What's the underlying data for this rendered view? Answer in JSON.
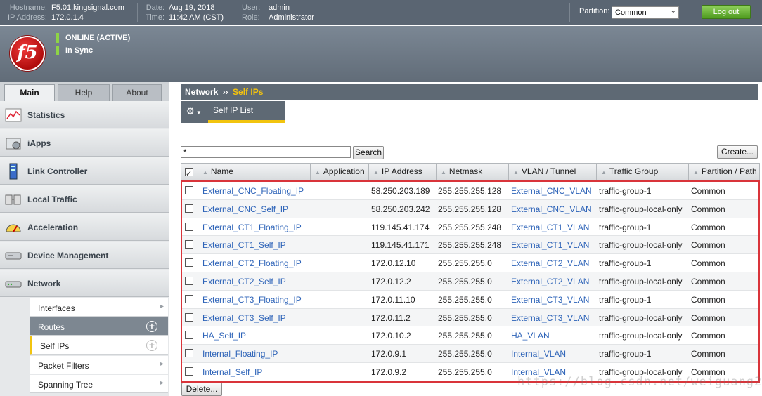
{
  "topbar": {
    "hostname_label": "Hostname:",
    "hostname": "F5.01.kingsignal.com",
    "ip_label": "IP Address:",
    "ip": "172.0.1.4",
    "date_label": "Date:",
    "date": "Aug 19, 2018",
    "time_label": "Time:",
    "time": "11:42 AM (CST)",
    "user_label": "User:",
    "user": "admin",
    "role_label": "Role:",
    "role": "Administrator",
    "partition_label": "Partition:",
    "partition_value": "Common",
    "logout_label": "Log out"
  },
  "header": {
    "logo_text": "f5",
    "status1": "ONLINE (ACTIVE)",
    "status2": "In Sync"
  },
  "tabs": [
    "Main",
    "Help",
    "About"
  ],
  "nav": {
    "items": [
      "Statistics",
      "iApps",
      "Link Controller",
      "Local Traffic",
      "Acceleration",
      "Device Management",
      "Network"
    ],
    "sub": [
      "Interfaces",
      "Routes",
      "Self IPs",
      "Packet Filters",
      "Spanning Tree"
    ]
  },
  "breadcrumb": {
    "section": "Network",
    "sep": "››",
    "current": "Self IPs"
  },
  "subtab": "Self IP List",
  "search": {
    "value": "*",
    "button": "Search"
  },
  "create_label": "Create...",
  "delete_label": "Delete...",
  "table": {
    "headers": [
      "Name",
      "Application",
      "IP Address",
      "Netmask",
      "VLAN / Tunnel",
      "Traffic Group",
      "Partition / Path"
    ],
    "rows": [
      {
        "name": "External_CNC_Floating_IP",
        "ip": "58.250.203.189",
        "mask": "255.255.255.128",
        "vlan": "External_CNC_VLAN",
        "tg": "traffic-group-1",
        "part": "Common"
      },
      {
        "name": "External_CNC_Self_IP",
        "ip": "58.250.203.242",
        "mask": "255.255.255.128",
        "vlan": "External_CNC_VLAN",
        "tg": "traffic-group-local-only",
        "part": "Common"
      },
      {
        "name": "External_CT1_Floating_IP",
        "ip": "119.145.41.174",
        "mask": "255.255.255.248",
        "vlan": "External_CT1_VLAN",
        "tg": "traffic-group-1",
        "part": "Common"
      },
      {
        "name": "External_CT1_Self_IP",
        "ip": "119.145.41.171",
        "mask": "255.255.255.248",
        "vlan": "External_CT1_VLAN",
        "tg": "traffic-group-local-only",
        "part": "Common"
      },
      {
        "name": "External_CT2_Floating_IP",
        "ip": "172.0.12.10",
        "mask": "255.255.255.0",
        "vlan": "External_CT2_VLAN",
        "tg": "traffic-group-1",
        "part": "Common"
      },
      {
        "name": "External_CT2_Self_IP",
        "ip": "172.0.12.2",
        "mask": "255.255.255.0",
        "vlan": "External_CT2_VLAN",
        "tg": "traffic-group-local-only",
        "part": "Common"
      },
      {
        "name": "External_CT3_Floating_IP",
        "ip": "172.0.11.10",
        "mask": "255.255.255.0",
        "vlan": "External_CT3_VLAN",
        "tg": "traffic-group-1",
        "part": "Common"
      },
      {
        "name": "External_CT3_Self_IP",
        "ip": "172.0.11.2",
        "mask": "255.255.255.0",
        "vlan": "External_CT3_VLAN",
        "tg": "traffic-group-local-only",
        "part": "Common"
      },
      {
        "name": "HA_Self_IP",
        "ip": "172.0.10.2",
        "mask": "255.255.255.0",
        "vlan": "HA_VLAN",
        "tg": "traffic-group-local-only",
        "part": "Common"
      },
      {
        "name": "Internal_Floating_IP",
        "ip": "172.0.9.1",
        "mask": "255.255.255.0",
        "vlan": "Internal_VLAN",
        "tg": "traffic-group-1",
        "part": "Common"
      },
      {
        "name": "Internal_Self_IP",
        "ip": "172.0.9.2",
        "mask": "255.255.255.0",
        "vlan": "Internal_VLAN",
        "tg": "traffic-group-local-only",
        "part": "Common"
      }
    ]
  },
  "watermark": "https://blog.csdn.net/weiguang2012",
  "colors": {
    "accent_yellow": "#f2c40f",
    "link_blue": "#2d63b8",
    "highlight_red": "#d9343a",
    "logout_green": "#4f9a1f"
  }
}
